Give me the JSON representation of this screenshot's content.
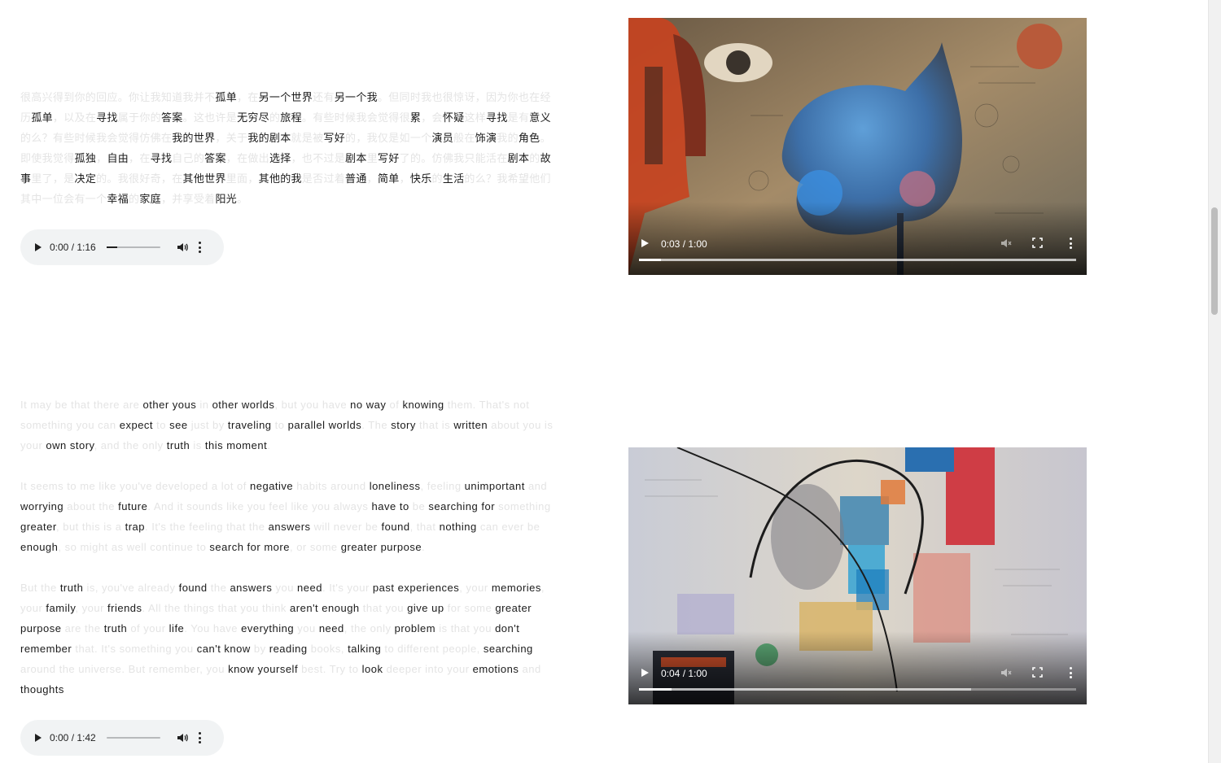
{
  "poem_cn": {
    "segments": [
      {
        "t": "很高兴得到你的回应。你让我知道我并不",
        "k": false
      },
      {
        "t": "孤单",
        "k": true
      },
      {
        "t": "，在",
        "k": false
      },
      {
        "t": "另一个世界",
        "k": true
      },
      {
        "t": "还有",
        "k": false
      },
      {
        "t": "另一个我",
        "k": true
      },
      {
        "t": "。但同时我也很惊讶，因为你也在经历",
        "k": false
      },
      {
        "t": "孤单",
        "k": true
      },
      {
        "t": "，以及在",
        "k": false
      },
      {
        "t": "寻找",
        "k": true
      },
      {
        "t": "属于你的",
        "k": false
      },
      {
        "t": "答案",
        "k": true
      },
      {
        "t": "。这也许是",
        "k": false
      },
      {
        "t": "无穷尽",
        "k": true
      },
      {
        "t": "的",
        "k": false
      },
      {
        "t": "旅程",
        "k": true
      },
      {
        "t": "。有些时候我会觉得很",
        "k": false
      },
      {
        "t": "累",
        "k": true
      },
      {
        "t": "，会",
        "k": false
      },
      {
        "t": "怀疑",
        "k": true
      },
      {
        "t": "这样",
        "k": false
      },
      {
        "t": "寻找",
        "k": true
      },
      {
        "t": "是有",
        "k": false
      },
      {
        "t": "意义",
        "k": true
      },
      {
        "t": "的么？有些时候我会觉得仿佛在",
        "k": false
      },
      {
        "t": "我的世界",
        "k": true
      },
      {
        "t": "，关于",
        "k": false
      },
      {
        "t": "我的剧本",
        "k": true
      },
      {
        "t": "就是被",
        "k": false
      },
      {
        "t": "写好",
        "k": true
      },
      {
        "t": "的，我仅是如一个",
        "k": false
      },
      {
        "t": "演员",
        "k": true
      },
      {
        "t": "般在",
        "k": false
      },
      {
        "t": "饰演",
        "k": true
      },
      {
        "t": "我的",
        "k": false
      },
      {
        "t": "角色",
        "k": true
      },
      {
        "t": "。即使我觉得",
        "k": false
      },
      {
        "t": "孤独",
        "k": true
      },
      {
        "t": "，",
        "k": false
      },
      {
        "t": "自由",
        "k": true
      },
      {
        "t": "，在",
        "k": false
      },
      {
        "t": "寻找",
        "k": true
      },
      {
        "t": "自己的",
        "k": false
      },
      {
        "t": "答案",
        "k": true
      },
      {
        "t": "，在做出",
        "k": false
      },
      {
        "t": "选择",
        "k": true
      },
      {
        "t": "，也不过是",
        "k": false
      },
      {
        "t": "剧本",
        "k": true
      },
      {
        "t": "里",
        "k": false
      },
      {
        "t": "写好",
        "k": true
      },
      {
        "t": "了的。仿佛我只能活在",
        "k": false
      },
      {
        "t": "剧本",
        "k": true
      },
      {
        "t": "的",
        "k": false
      },
      {
        "t": "故事",
        "k": true
      },
      {
        "t": "里了，是",
        "k": false
      },
      {
        "t": "决定",
        "k": true
      },
      {
        "t": "的。我很好奇，在",
        "k": false
      },
      {
        "t": "其他世界",
        "k": true
      },
      {
        "t": "里面，",
        "k": false
      },
      {
        "t": "其他的我",
        "k": true
      },
      {
        "t": "是否过着",
        "k": false
      },
      {
        "t": "普通",
        "k": true
      },
      {
        "t": "，",
        "k": false
      },
      {
        "t": "简单",
        "k": true
      },
      {
        "t": "，",
        "k": false
      },
      {
        "t": "快乐",
        "k": true
      },
      {
        "t": "的",
        "k": false
      },
      {
        "t": "生活",
        "k": true
      },
      {
        "t": "的么？我希望他们其中一位会有一个",
        "k": false
      },
      {
        "t": "幸福",
        "k": true
      },
      {
        "t": "的",
        "k": false
      },
      {
        "t": "家庭",
        "k": true
      },
      {
        "t": "，并享受着",
        "k": false
      },
      {
        "t": "阳光",
        "k": true
      },
      {
        "t": "。",
        "k": false
      }
    ]
  },
  "audio_1": {
    "time": "0:00 / 1:16",
    "progress": 0.2
  },
  "video_1": {
    "time": "0:03 / 1:00",
    "progress": 0.05,
    "buffered": 1.0
  },
  "reply_en": {
    "paragraphs": [
      [
        {
          "t": "It may be that there are ",
          "k": false
        },
        {
          "t": "other yous",
          "k": true
        },
        {
          "t": " in ",
          "k": false
        },
        {
          "t": "other worlds",
          "k": true
        },
        {
          "t": ", but you have ",
          "k": false
        },
        {
          "t": "no way",
          "k": true
        },
        {
          "t": " of ",
          "k": false
        },
        {
          "t": "knowing",
          "k": true
        },
        {
          "t": " them. That's not something you can ",
          "k": false
        },
        {
          "t": "expect",
          "k": true
        },
        {
          "t": " to ",
          "k": false
        },
        {
          "t": "see",
          "k": true
        },
        {
          "t": " just by ",
          "k": false
        },
        {
          "t": "traveling",
          "k": true
        },
        {
          "t": " to ",
          "k": false
        },
        {
          "t": "parallel worlds",
          "k": true
        },
        {
          "t": ". The ",
          "k": false
        },
        {
          "t": "story",
          "k": true
        },
        {
          "t": " that is ",
          "k": false
        },
        {
          "t": "written",
          "k": true
        },
        {
          "t": " about you is your ",
          "k": false
        },
        {
          "t": "own story",
          "k": true
        },
        {
          "t": ", and the only ",
          "k": false
        },
        {
          "t": "truth",
          "k": true
        },
        {
          "t": " is ",
          "k": false
        },
        {
          "t": "this moment",
          "k": true
        },
        {
          "t": ".",
          "k": false
        }
      ],
      [
        {
          "t": "It seems to me like you've developed a lot of ",
          "k": false
        },
        {
          "t": "negative",
          "k": true
        },
        {
          "t": " habits around ",
          "k": false
        },
        {
          "t": "loneliness",
          "k": true
        },
        {
          "t": ", feeling ",
          "k": false
        },
        {
          "t": "unimportant",
          "k": true
        },
        {
          "t": " and ",
          "k": false
        },
        {
          "t": "worrying",
          "k": true
        },
        {
          "t": " about the ",
          "k": false
        },
        {
          "t": "future",
          "k": true
        },
        {
          "t": ". And it sounds like you feel like you always ",
          "k": false
        },
        {
          "t": "have to",
          "k": true
        },
        {
          "t": " be ",
          "k": false
        },
        {
          "t": "searching for",
          "k": true
        },
        {
          "t": " something ",
          "k": false
        },
        {
          "t": "greater",
          "k": true
        },
        {
          "t": ", but this is a ",
          "k": false
        },
        {
          "t": "trap",
          "k": true
        },
        {
          "t": ". It's the feeling that the ",
          "k": false
        },
        {
          "t": "answers",
          "k": true
        },
        {
          "t": " will never be ",
          "k": false
        },
        {
          "t": "found",
          "k": true
        },
        {
          "t": ", that ",
          "k": false
        },
        {
          "t": "nothing",
          "k": true
        },
        {
          "t": " can ever be ",
          "k": false
        },
        {
          "t": "enough",
          "k": true
        },
        {
          "t": ", so might as well continue to ",
          "k": false
        },
        {
          "t": "search for more",
          "k": true
        },
        {
          "t": ", or some ",
          "k": false
        },
        {
          "t": "greater purpose",
          "k": true
        },
        {
          "t": ".",
          "k": false
        }
      ],
      [
        {
          "t": "But the ",
          "k": false
        },
        {
          "t": "truth",
          "k": true
        },
        {
          "t": " is, you've already ",
          "k": false
        },
        {
          "t": "found",
          "k": true
        },
        {
          "t": " the ",
          "k": false
        },
        {
          "t": "answers",
          "k": true
        },
        {
          "t": " you ",
          "k": false
        },
        {
          "t": "need",
          "k": true
        },
        {
          "t": ". It's your ",
          "k": false
        },
        {
          "t": "past experiences",
          "k": true
        },
        {
          "t": ", your ",
          "k": false
        },
        {
          "t": "memories",
          "k": true
        },
        {
          "t": ", your ",
          "k": false
        },
        {
          "t": "family",
          "k": true
        },
        {
          "t": ", your ",
          "k": false
        },
        {
          "t": "friends",
          "k": true
        },
        {
          "t": ". All the things that you think ",
          "k": false
        },
        {
          "t": "aren't enough",
          "k": true
        },
        {
          "t": " that you ",
          "k": false
        },
        {
          "t": "give up",
          "k": true
        },
        {
          "t": " for some ",
          "k": false
        },
        {
          "t": "greater purpose",
          "k": true
        },
        {
          "t": " are the ",
          "k": false
        },
        {
          "t": "truth",
          "k": true
        },
        {
          "t": " of your ",
          "k": false
        },
        {
          "t": "life",
          "k": true
        },
        {
          "t": ". You have ",
          "k": false
        },
        {
          "t": "everything",
          "k": true
        },
        {
          "t": " you ",
          "k": false
        },
        {
          "t": "need",
          "k": true
        },
        {
          "t": ", the only ",
          "k": false
        },
        {
          "t": "problem",
          "k": true
        },
        {
          "t": " is that you ",
          "k": false
        },
        {
          "t": "don't remember",
          "k": true
        },
        {
          "t": " that. It's something you ",
          "k": false
        },
        {
          "t": "can't know",
          "k": true
        },
        {
          "t": " by ",
          "k": false
        },
        {
          "t": "reading",
          "k": true
        },
        {
          "t": " books, ",
          "k": false
        },
        {
          "t": "talking",
          "k": true
        },
        {
          "t": " to different people, ",
          "k": false
        },
        {
          "t": "searching",
          "k": true
        },
        {
          "t": " around the universe. But remember, you ",
          "k": false
        },
        {
          "t": "know yourself",
          "k": true
        },
        {
          "t": " best. Try to ",
          "k": false
        },
        {
          "t": "look",
          "k": true
        },
        {
          "t": " deeper into your ",
          "k": false
        },
        {
          "t": "emotions",
          "k": true
        },
        {
          "t": " and ",
          "k": false
        },
        {
          "t": "thoughts",
          "k": true
        }
      ]
    ]
  },
  "audio_2": {
    "time": "0:00 / 1:42",
    "progress": 0.0
  },
  "video_2": {
    "time": "0:04 / 1:00",
    "progress": 0.075,
    "buffered": 0.76
  },
  "icons": {
    "play": "play-icon",
    "volume": "volume-icon",
    "more": "more-vert-icon",
    "mute": "muted-icon",
    "fullscreen": "fullscreen-icon"
  }
}
